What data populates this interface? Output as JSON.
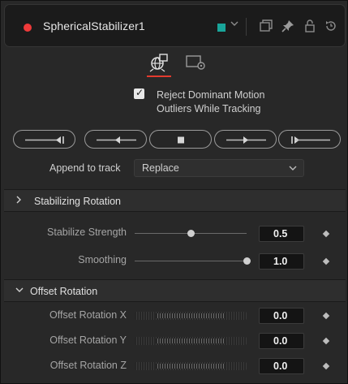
{
  "header": {
    "title": "SphericalStabilizer1",
    "tool_color": "#19a59a",
    "status_color": "#ef3a3a",
    "icons": [
      "color-dropdown-chevron-icon",
      "window-icon",
      "pin-icon",
      "lock-icon",
      "reset-icon"
    ]
  },
  "tabs": [
    {
      "icon": "spherical-stabilizer-controls-icon",
      "active": true
    },
    {
      "icon": "settings-icon",
      "active": false
    }
  ],
  "options": {
    "reject_outliers": {
      "label": "Reject Dominant Motion Outliers While Tracking",
      "line1": "Reject Dominant Motion",
      "line2": "Outliers While Tracking",
      "checked": true
    }
  },
  "track_buttons": [
    "track-backward-from-end",
    "track-backward",
    "stop-tracking",
    "track-forward",
    "track-forward-from-start"
  ],
  "append": {
    "label": "Append to track",
    "value": "Replace"
  },
  "sections": {
    "stabilizing_rotation": {
      "label": "Stabilizing Rotation",
      "expanded": false
    },
    "stabilize": {
      "rows": [
        {
          "label": "Stabilize Strength",
          "value": "0.5",
          "fraction": 0.5
        },
        {
          "label": "Smoothing",
          "value": "1.0",
          "fraction": 1.0
        }
      ]
    },
    "offset_rotation": {
      "label": "Offset Rotation",
      "expanded": true,
      "rows": [
        {
          "label": "Offset Rotation X",
          "value": "0.0"
        },
        {
          "label": "Offset Rotation Y",
          "value": "0.0"
        },
        {
          "label": "Offset Rotation Z",
          "value": "0.0"
        }
      ]
    }
  },
  "colors": {
    "accent": "#e33b2e",
    "panel": "#282828",
    "header": "#1b1b1b"
  }
}
